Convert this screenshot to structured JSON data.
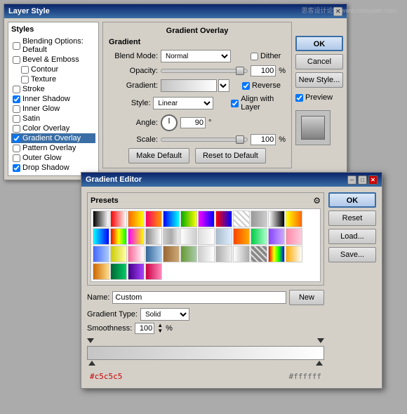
{
  "layerStyle": {
    "title": "Layer Style",
    "sidebar": {
      "label": "Styles",
      "items": [
        {
          "id": "blending",
          "label": "Blending Options: Default",
          "checked": false,
          "indent": false
        },
        {
          "id": "bevel",
          "label": "Bevel & Emboss",
          "checked": false,
          "indent": false
        },
        {
          "id": "contour",
          "label": "Contour",
          "checked": false,
          "indent": true
        },
        {
          "id": "texture",
          "label": "Texture",
          "checked": false,
          "indent": true
        },
        {
          "id": "stroke",
          "label": "Stroke",
          "checked": false,
          "indent": false
        },
        {
          "id": "inner-shadow",
          "label": "Inner Shadow",
          "checked": true,
          "indent": false
        },
        {
          "id": "inner-glow",
          "label": "Inner Glow",
          "checked": false,
          "indent": false
        },
        {
          "id": "satin",
          "label": "Satin",
          "checked": false,
          "indent": false
        },
        {
          "id": "color-overlay",
          "label": "Color Overlay",
          "checked": false,
          "indent": false
        },
        {
          "id": "gradient-overlay",
          "label": "Gradient Overlay",
          "checked": true,
          "indent": false,
          "selected": true
        },
        {
          "id": "pattern-overlay",
          "label": "Pattern Overlay",
          "checked": false,
          "indent": false
        },
        {
          "id": "outer-glow",
          "label": "Outer Glow",
          "checked": false,
          "indent": false
        },
        {
          "id": "drop-shadow",
          "label": "Drop Shadow",
          "checked": true,
          "indent": false
        }
      ]
    },
    "gradientOverlay": {
      "sectionTitle": "Gradient Overlay",
      "subtitle": "Gradient",
      "blendMode": {
        "label": "Blend Mode:",
        "value": "Normal"
      },
      "dither": {
        "label": "Dither",
        "checked": false
      },
      "opacity": {
        "label": "Opacity:",
        "value": "100",
        "unit": "%"
      },
      "gradient": {
        "label": "Gradient:"
      },
      "reverse": {
        "label": "Reverse",
        "checked": true
      },
      "style": {
        "label": "Style:",
        "value": "Linear"
      },
      "alignWithLayer": {
        "label": "Align with Layer",
        "checked": true
      },
      "angle": {
        "label": "Angle:",
        "value": "90",
        "unit": "°"
      },
      "scale": {
        "label": "Scale:",
        "value": "100",
        "unit": "%"
      },
      "makeDefaultBtn": "Make Default",
      "resetToDefaultBtn": "Reset to Default"
    },
    "buttons": {
      "ok": "OK",
      "cancel": "Cancel",
      "newStyle": "New Style...",
      "preview": "Preview"
    }
  },
  "gradientEditor": {
    "title": "Gradient Editor",
    "presets": {
      "label": "Presets",
      "swatches": [
        {
          "colors": [
            "#000000",
            "#ffffff"
          ],
          "type": "linear"
        },
        {
          "colors": [
            "#ff0000",
            "#ffffff"
          ],
          "type": "linear"
        },
        {
          "colors": [
            "#ff6600",
            "#ffff00"
          ],
          "type": "linear"
        },
        {
          "colors": [
            "#ff0066",
            "#ff9900"
          ],
          "type": "linear"
        },
        {
          "colors": [
            "#0000ff",
            "#00ffff"
          ],
          "type": "linear"
        },
        {
          "colors": [
            "#00aa00",
            "#ffff00"
          ],
          "type": "linear"
        },
        {
          "colors": [
            "#ff00ff",
            "#0000ff"
          ],
          "type": "linear"
        },
        {
          "colors": [
            "#ff0000",
            "#0000ff"
          ],
          "type": "linear"
        },
        {
          "colors": [
            "#cccccc",
            "#ffffff"
          ],
          "type": "checker"
        },
        {
          "colors": [
            "#999999",
            "#cccccc"
          ],
          "type": "linear"
        },
        {
          "colors": [
            "#ffffff",
            "#000000"
          ],
          "type": "linear"
        },
        {
          "colors": [
            "#ffff00",
            "#ff6600"
          ],
          "type": "linear"
        },
        {
          "colors": [
            "#00ffff",
            "#0000ff"
          ],
          "type": "linear"
        },
        {
          "colors": [
            "#ff0000",
            "#ffff00",
            "#00ff00"
          ],
          "type": "linear3"
        },
        {
          "colors": [
            "#ff00ff",
            "#ffff00"
          ],
          "type": "linear"
        },
        {
          "colors": [
            "#888888",
            "#ffffff"
          ],
          "type": "linear"
        },
        {
          "colors": [
            "#cccccc",
            "#aaaaaa",
            "#eeeeee"
          ],
          "type": "metallic"
        },
        {
          "colors": [
            "#ffffff",
            "#cccccc"
          ],
          "type": "linear"
        },
        {
          "colors": [
            "#dddddd",
            "#ffffff"
          ],
          "type": "linear"
        },
        {
          "colors": [
            "#aabbcc",
            "#ddeeff"
          ],
          "type": "linear"
        },
        {
          "colors": [
            "#ff4400",
            "#ffaa00"
          ],
          "type": "linear"
        },
        {
          "colors": [
            "#00cc44",
            "#aaffcc"
          ],
          "type": "linear"
        },
        {
          "colors": [
            "#8844ff",
            "#ccaaff"
          ],
          "type": "linear"
        },
        {
          "colors": [
            "#ff88aa",
            "#ffccdd"
          ],
          "type": "linear"
        },
        {
          "colors": [
            "#4466ff",
            "#aaccff"
          ],
          "type": "linear"
        },
        {
          "colors": [
            "#cccc00",
            "#ffffaa"
          ],
          "type": "linear"
        },
        {
          "colors": [
            "#ff6699",
            "#ffffff"
          ],
          "type": "linear"
        },
        {
          "colors": [
            "#336699",
            "#aaccee"
          ],
          "type": "linear"
        },
        {
          "colors": [
            "#996633",
            "#ccaa77"
          ],
          "type": "linear"
        },
        {
          "colors": [
            "#669933",
            "#aaccaa"
          ],
          "type": "linear"
        },
        {
          "colors": [
            "#cccccc",
            "#ffffff"
          ],
          "type": "linear"
        },
        {
          "colors": [
            "#aaaaaa",
            "#eeeeee"
          ],
          "type": "linear"
        },
        {
          "colors": [
            "#ffffff",
            "#aaaaaa"
          ],
          "type": "linear"
        },
        {
          "colors": [
            "#dddddd",
            "#888888"
          ],
          "type": "checker"
        },
        {
          "colors": [
            "#ff0000",
            "#ffff00",
            "#00ff00",
            "#0000ff"
          ],
          "type": "rainbow"
        },
        {
          "colors": [
            "#ffaa00",
            "#ffffff"
          ],
          "type": "linear"
        }
      ]
    },
    "buttons": {
      "ok": "OK",
      "reset": "Reset",
      "load": "Load...",
      "save": "Save...",
      "new": "New"
    },
    "nameLabel": "Name:",
    "nameValue": "Custom",
    "gradientTypeLabel": "Gradient Type:",
    "gradientTypeValue": "Solid",
    "smoothnessLabel": "Smoothness:",
    "smoothnessValue": "100",
    "smoothnessUnit": "%",
    "colorStop1": "#c5c5c5",
    "colorStop2": "#ffffff"
  },
  "watermark": "思客设计论坛 www.missyuan.com"
}
